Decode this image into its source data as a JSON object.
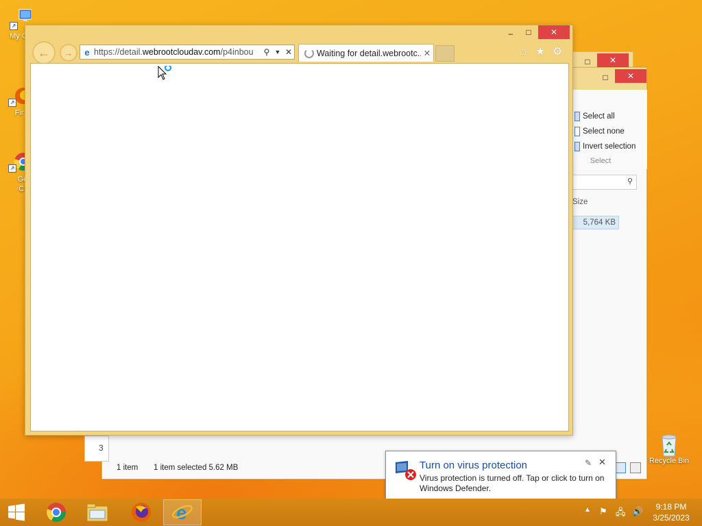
{
  "desktop": {
    "icons": [
      {
        "label": "My Co",
        "icon": "computer-icon"
      },
      {
        "label": "Fir",
        "icon": "firefox-icon"
      },
      {
        "label": "Goo Chr",
        "icon": "chrome-icon"
      },
      {
        "label": "Recycle Bin",
        "icon": "recycle-bin-icon"
      }
    ]
  },
  "explorer": {
    "ribbon": {
      "select_all": "Select all",
      "select_none": "Select none",
      "invert_selection": "Invert selection",
      "group": "Select"
    },
    "columns": {
      "size": "Size"
    },
    "row": {
      "size": "5,764 KB"
    },
    "status": {
      "item_count": "1 item",
      "selected": "1 item selected  5.62 MB"
    },
    "small_text": "3"
  },
  "ie": {
    "address": {
      "prefix": "https://detail.",
      "domain": "webrootcloudav.com",
      "suffix": "/p4inbou"
    },
    "tab": {
      "label": "Waiting for detail.webrootc..."
    }
  },
  "toast": {
    "title": "Turn on virus protection",
    "body": "Virus protection is turned off. Tap or click to turn on Windows Defender."
  },
  "taskbar": {
    "time": "9:18 PM",
    "date": "3/25/2023",
    "apps": [
      "start",
      "chrome",
      "file-explorer",
      "firefox",
      "internet-explorer"
    ],
    "active_app": "internet-explorer"
  },
  "colors": {
    "accent": "#f4d37f",
    "desktop": "#f6a81a",
    "close": "#e04343",
    "toast_title": "#1a4d9c"
  }
}
